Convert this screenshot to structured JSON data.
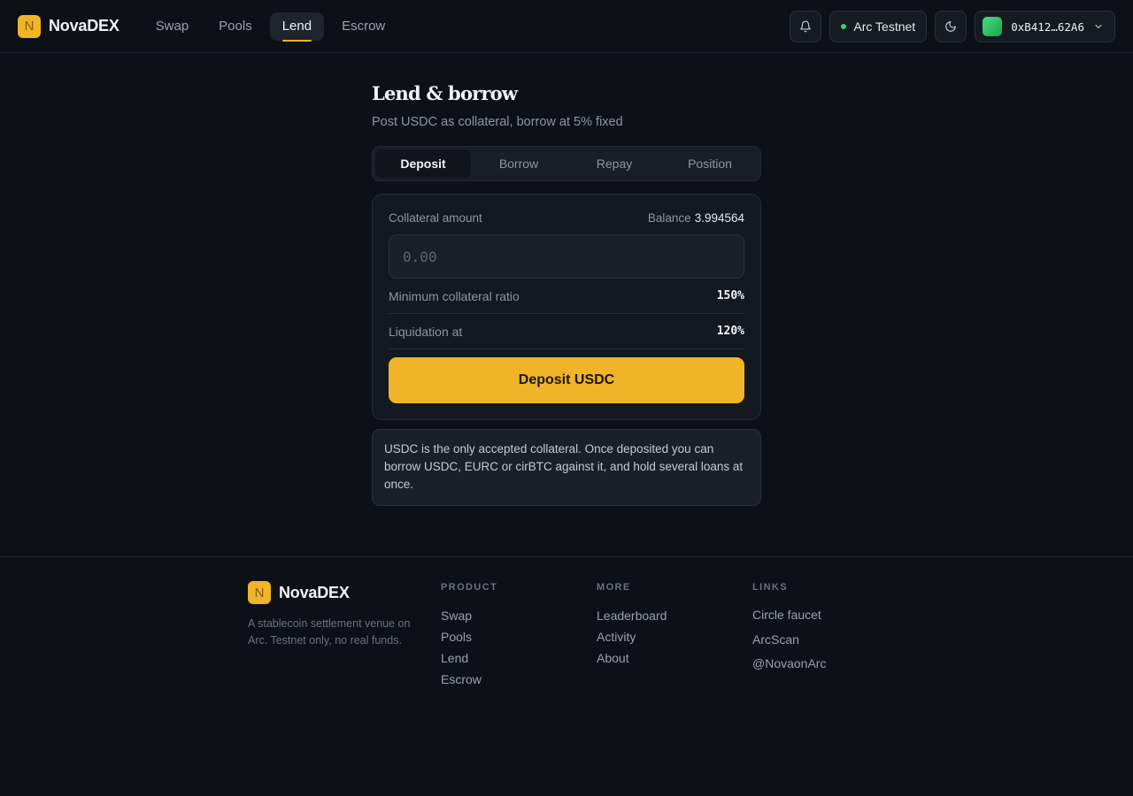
{
  "brand": {
    "logo_letter": "N",
    "name": "NovaDEX",
    "accent": "#f0b429"
  },
  "nav": [
    {
      "label": "Swap",
      "active": false
    },
    {
      "label": "Pools",
      "active": false
    },
    {
      "label": "Lend",
      "active": true
    },
    {
      "label": "Escrow",
      "active": false
    }
  ],
  "header": {
    "network_label": "Arc Testnet",
    "network_status_color": "#34d27b",
    "wallet_address": "0xB412…62A6",
    "icons": [
      "bell-icon",
      "moon-icon",
      "chevron-down-icon"
    ]
  },
  "page": {
    "title": "Lend & borrow",
    "subtitle": "Post USDC as collateral, borrow at 5% fixed"
  },
  "tabs": [
    {
      "label": "Deposit",
      "active": true
    },
    {
      "label": "Borrow",
      "active": false
    },
    {
      "label": "Repay",
      "active": false
    },
    {
      "label": "Position",
      "active": false
    }
  ],
  "form": {
    "amount_label": "Collateral amount",
    "balance_label": "Balance",
    "balance_value": "3.994564",
    "amount_placeholder": "0.00",
    "amount_value": "",
    "stats": [
      {
        "label": "Minimum collateral ratio",
        "value": "150%"
      },
      {
        "label": "Liquidation at",
        "value": "120%"
      }
    ],
    "submit_label": "Deposit USDC"
  },
  "info_text": "USDC is the only accepted collateral. Once deposited you can borrow USDC, EURC or cirBTC against it, and hold several loans at once.",
  "footer": {
    "brand_name": "NovaDEX",
    "brand_letter": "N",
    "description": "A stablecoin settlement venue on Arc. Testnet only, no real funds.",
    "columns": [
      {
        "title": "PRODUCT",
        "links": [
          "Swap",
          "Pools",
          "Lend",
          "Escrow"
        ]
      },
      {
        "title": "MORE",
        "links": [
          "Leaderboard",
          "Activity",
          "About"
        ]
      },
      {
        "title": "LINKS",
        "links": [
          "Circle faucet",
          "ArcScan",
          "@NovaonArc"
        ]
      }
    ]
  }
}
